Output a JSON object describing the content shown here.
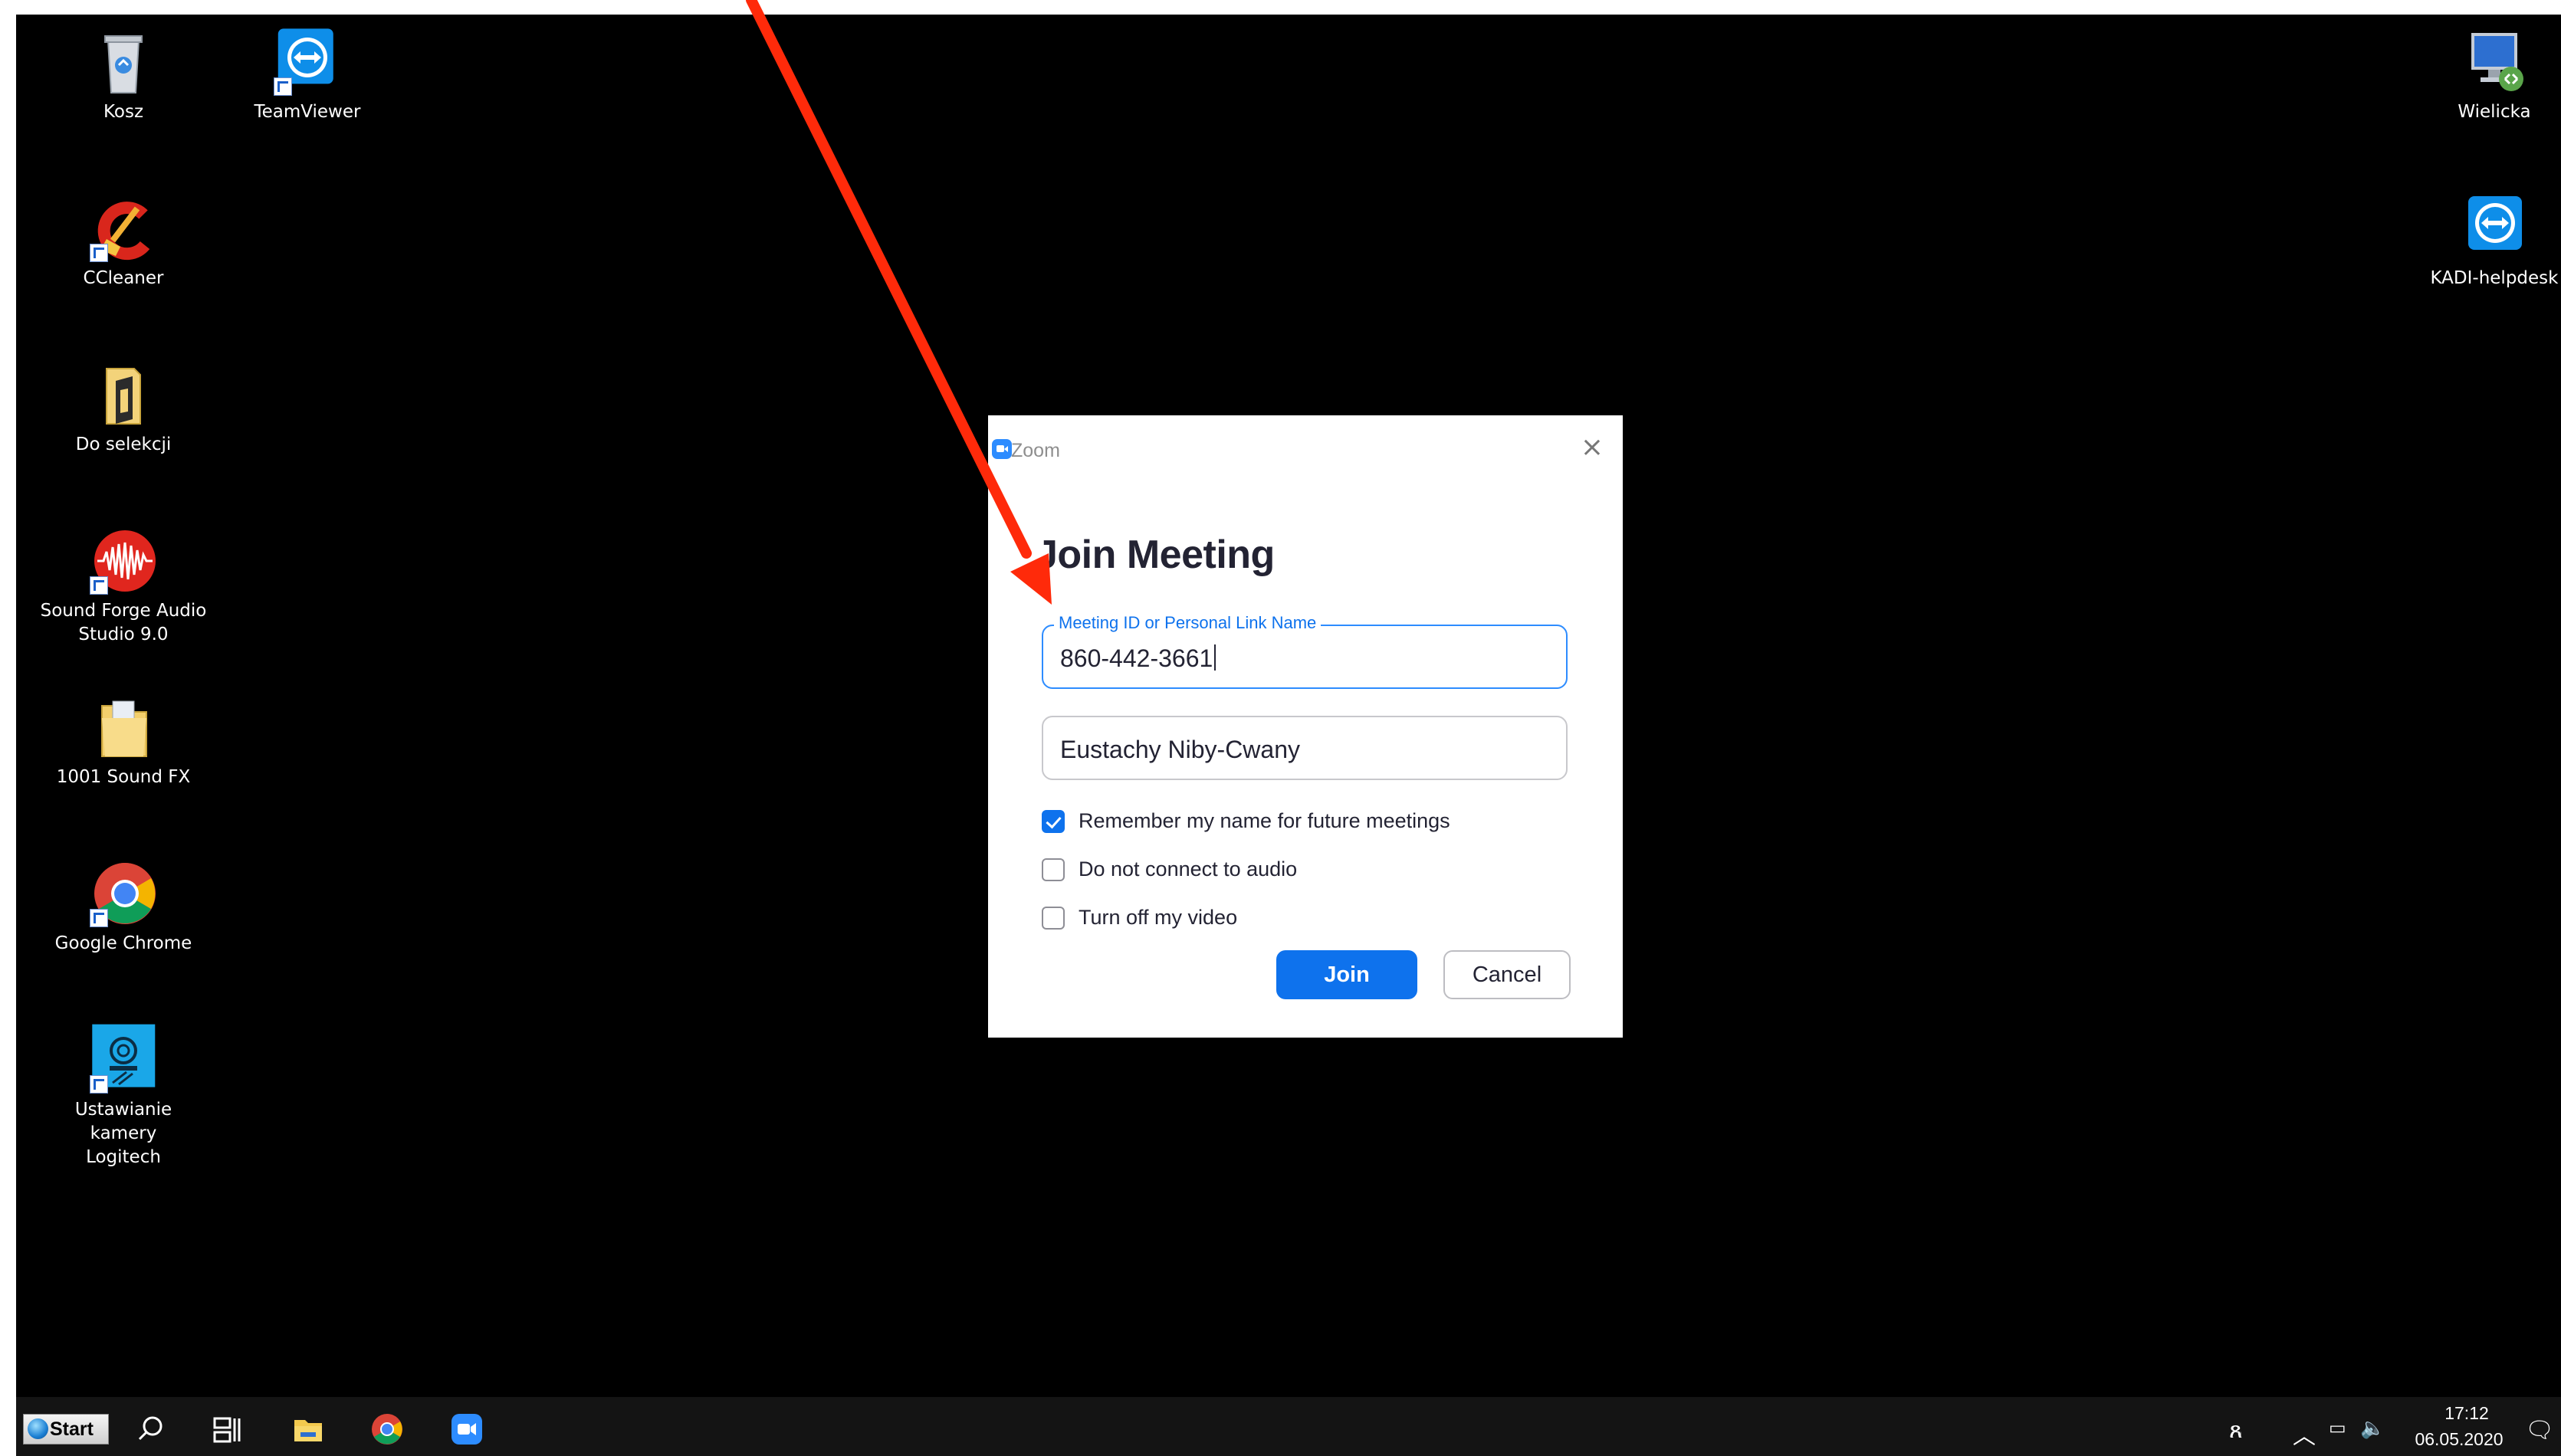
{
  "desktop": {
    "icons_left": [
      {
        "name": "recycle-bin-icon",
        "label": "Kosz"
      },
      {
        "name": "teamviewer-icon",
        "label": "TeamViewer"
      },
      {
        "name": "ccleaner-icon",
        "label": "CCleaner"
      },
      {
        "name": "folder-icon",
        "label": "Do selekcji"
      },
      {
        "name": "sound-forge-icon",
        "label_line1": "Sound Forge Audio",
        "label_line2": "Studio 9.0"
      },
      {
        "name": "folder-icon",
        "label": "1001 Sound FX"
      },
      {
        "name": "chrome-icon",
        "label": "Google Chrome"
      },
      {
        "name": "logitech-camera-icon",
        "label_line1": "Ustawianie kamery",
        "label_line2": "Logitech"
      }
    ],
    "icons_right": [
      {
        "name": "remote-desktop-icon",
        "label": "Wielicka"
      },
      {
        "name": "teamviewer-icon",
        "label": "KADI-helpdesk"
      }
    ]
  },
  "dialog": {
    "app_name": "Zoom",
    "heading": "Join Meeting",
    "meeting_id": {
      "label": "Meeting ID or Personal Link Name",
      "value": "860-442-3661"
    },
    "display_name": {
      "value": "Eustachy Niby-Cwany"
    },
    "options": [
      {
        "label": "Remember my name for future meetings",
        "checked": true
      },
      {
        "label": "Do not connect to audio",
        "checked": false
      },
      {
        "label": "Turn off my video",
        "checked": false
      }
    ],
    "join_label": "Join",
    "cancel_label": "Cancel"
  },
  "taskbar": {
    "start_label": "Start",
    "time": "17:12",
    "date": "06.05.2020"
  },
  "colors": {
    "desktop": "#000000",
    "zoom_blue": "#0e72ed",
    "annotation_arrow": "#ff2a0a"
  }
}
